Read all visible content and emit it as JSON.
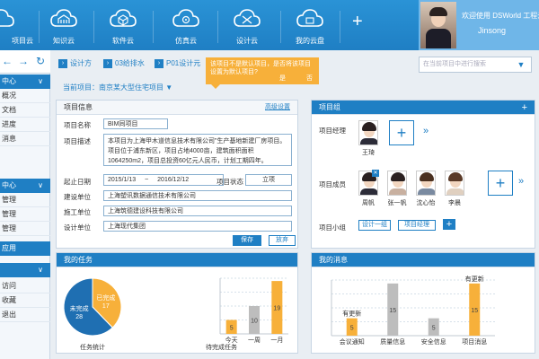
{
  "nav": [
    {
      "label": "项目云"
    },
    {
      "label": "知识云"
    },
    {
      "label": "软件云"
    },
    {
      "label": "仿真云"
    },
    {
      "label": "设计云"
    },
    {
      "label": "我的云盘"
    }
  ],
  "user": {
    "welcome": "欢迎使用 DSWorld 工程云",
    "name": "Jinsong"
  },
  "sidebar": {
    "sections": [
      {
        "title": "中心",
        "items": [
          "概况",
          "文档",
          "进度",
          "消息"
        ]
      },
      {
        "title": "中心",
        "items": [
          "管理",
          "管理",
          "管理"
        ]
      },
      {
        "title": "应用",
        "items": []
      },
      {
        "title": "",
        "items": [
          "访问",
          "收藏",
          "退出"
        ]
      }
    ]
  },
  "breadcrumb": [
    "设计方",
    "03给排水",
    "P01设计元"
  ],
  "tooltip": {
    "text": "该项目不是默认项目，是否将该项目设置为默认项目?",
    "yes": "是",
    "no": "否"
  },
  "search": {
    "placeholder": "在当前项目中进行搜索"
  },
  "current_project": "当前项目：南京某大型住宅项目 ▼",
  "project_info": {
    "title": "项目信息",
    "advanced": "高级设置",
    "name_label": "项目名称",
    "name_value": "BIM同项目",
    "desc_label": "项目描述",
    "desc_value": "本项目为上海甲木道信息技术有限公司”生产基地新建厂房项目。项目位于浦东新区，项目占地4000亩，建筑面积面积1064250m2，项目总投资60亿元人民币，计划工期四年。",
    "start_label": "起止日期",
    "start": "2015/1/13",
    "sep": "~",
    "end": "2016/12/12",
    "status_label": "项目状态",
    "status": "立项",
    "builder_label": "建设单位",
    "builder": "上海塑讯数据通信技术有限公司",
    "construct_label": "施工单位",
    "construct": "上海筑德建设科技有限公司",
    "design_label": "设计单位",
    "design": "上海现代集团",
    "save": "保存",
    "discard": "放弃"
  },
  "project_group": {
    "title": "项目组",
    "manager_label": "项目经理",
    "manager": "王琦",
    "members_label": "项目成员",
    "members": [
      "周帆",
      "张一帆",
      "沈心怡",
      "李晨"
    ],
    "subgroup_label": "项目小组",
    "subgroups": [
      "设计一组",
      "项目经理"
    ]
  },
  "my_tasks": {
    "title": "我的任务",
    "pie_caption": "任务统计",
    "bar_caption": "待完成任务"
  },
  "my_messages": {
    "title": "我的消息"
  },
  "chart_data": [
    {
      "type": "pie",
      "categories": [
        "已完成",
        "未完成"
      ],
      "values": [
        17,
        28
      ],
      "colors": [
        "#f7b03a",
        "#1f6fb2"
      ]
    },
    {
      "type": "bar",
      "categories": [
        "今天",
        "一周",
        "一月"
      ],
      "values": [
        5,
        10,
        19
      ],
      "colors": [
        "#f7b03a",
        "#bdbdbd",
        "#f7b03a"
      ],
      "ylim": [
        0,
        20
      ],
      "grid": true
    },
    {
      "type": "bar",
      "categories": [
        "会议通知",
        "质量信息",
        "安全信息",
        "项目消息"
      ],
      "values": [
        5,
        15,
        5,
        15
      ],
      "colors": [
        "#f7b03a",
        "#bdbdbd",
        "#bdbdbd",
        "#f7b03a"
      ],
      "annotations": [
        "有更新",
        "",
        "",
        "有更新"
      ],
      "ylim": [
        0,
        16
      ],
      "grid": true
    }
  ]
}
